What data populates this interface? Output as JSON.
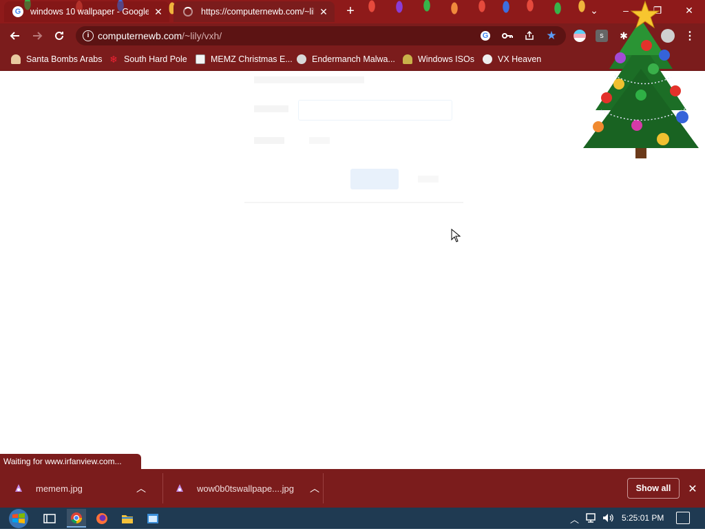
{
  "browser": {
    "tabs": [
      {
        "title": "windows 10 wallpaper - Google",
        "favicon": "google-icon",
        "active": false
      },
      {
        "title": "https://computernewb.com/~lily",
        "favicon": "loading-spinner-icon",
        "active": true
      }
    ],
    "window_controls": {
      "tab_search": "⌄",
      "minimize": "–",
      "restore": "❐",
      "close": "✕"
    },
    "omnibox": {
      "domain": "computernewb.com",
      "path": "/~lily/vxh/"
    },
    "bookmarks": [
      {
        "label": "Santa Bombs Arabs",
        "icon": "santa-icon"
      },
      {
        "label": "South Hard Pole",
        "icon": "snowflake-icon"
      },
      {
        "label": "MEMZ Christmas E...",
        "icon": "memz-icon"
      },
      {
        "label": "Endermanch Malwa...",
        "icon": "endermanch-icon"
      },
      {
        "label": "Windows ISOs",
        "icon": "windows-iso-icon"
      },
      {
        "label": "VX Heaven",
        "icon": "vx-heaven-icon"
      }
    ]
  },
  "status_bar": {
    "text": "Waiting for www.irfanview.com..."
  },
  "downloads": {
    "items": [
      {
        "filename": "memem.jpg"
      },
      {
        "filename": "wow0b0tswallpape....jpg"
      }
    ],
    "show_all": "Show all"
  },
  "taskbar": {
    "time": "5:25:01 PM"
  },
  "colors": {
    "chrome_theme": "#7b1c1c",
    "tabstrip": "#8e1a1a",
    "taskbar": "#1f3a52"
  }
}
